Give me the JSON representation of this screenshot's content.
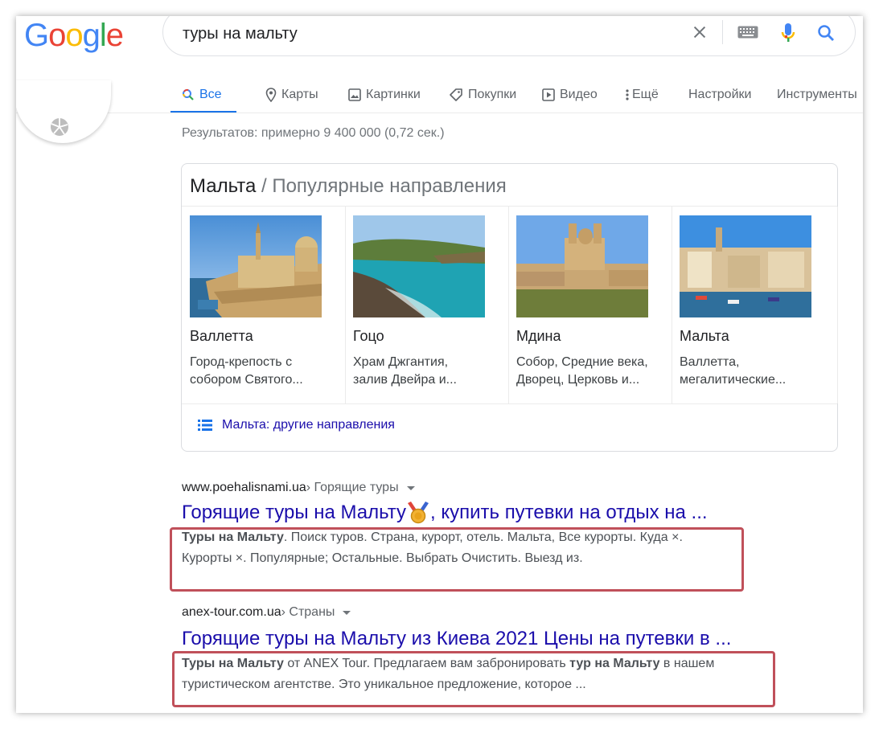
{
  "brand": {
    "logo_letters": [
      "G",
      "o",
      "o",
      "g",
      "l",
      "e"
    ],
    "logo_colors": [
      "#4285F4",
      "#EA4335",
      "#FBBC05",
      "#4285F4",
      "#34A853",
      "#EA4335"
    ]
  },
  "search": {
    "query": "туры на мальту"
  },
  "tabs": [
    {
      "label": "Все",
      "icon": "search-icon",
      "active": true
    },
    {
      "label": "Карты",
      "icon": "map-pin-icon"
    },
    {
      "label": "Картинки",
      "icon": "image-icon"
    },
    {
      "label": "Покупки",
      "icon": "tag-icon"
    },
    {
      "label": "Видео",
      "icon": "play-icon"
    },
    {
      "label": "Ещё",
      "icon": "more-vert-icon"
    },
    {
      "label": "Настройки"
    },
    {
      "label": "Инструменты"
    }
  ],
  "stats": "Результатов: примерно 9 400 000 (0,72 сек.)",
  "destinations": {
    "title": "Мальта",
    "subtitle": " / Популярные направления",
    "places": [
      {
        "name": "Валлетта",
        "desc_1": "Город-крепость с",
        "desc_2": "собором Святого..."
      },
      {
        "name": "Гоцо",
        "desc_1": "Храм Джгантия,",
        "desc_2": "залив Двейра и..."
      },
      {
        "name": "Мдина",
        "desc_1": "Собор, Средние века,",
        "desc_2": "Дворец, Церковь и..."
      },
      {
        "name": "Мальта",
        "desc_1": "Валлетта,",
        "desc_2": "мегалитические..."
      }
    ],
    "more_link": "Мальта: другие направления"
  },
  "results": [
    {
      "domain": "www.poehalisnami.ua",
      "crumb": " › Горящие туры",
      "title": "Горящие туры на Мальту",
      "title_tail": ", купить путевки на отдых на ...",
      "snip_b1": "Туры на Мальту",
      "snip_t1": ". Поиск туров. Страна, курорт, отель. Мальта, Все курорты. Куда ×.",
      "snip_line2": "Курорты ×. Популярные; Остальные. Выбрать Очистить. Выезд из."
    },
    {
      "domain": "anex-tour.com.ua",
      "crumb": " › Страны",
      "title": "Горящие туры на Мальту из Киева 2021 Цены на путевки в ...",
      "snip_b1": "Туры на Мальту",
      "snip_t1": " от ANEX Tour. Предлагаем вам забронировать ",
      "snip_b2": "тур на Мальту",
      "snip_t2": " в нашем",
      "snip_line2": "туристическом агентстве. Это уникальное предложение, которое ..."
    }
  ],
  "colors": {
    "link": "#1a0dab",
    "accent": "#1a73e8",
    "highlight_box": "#c0505a"
  }
}
